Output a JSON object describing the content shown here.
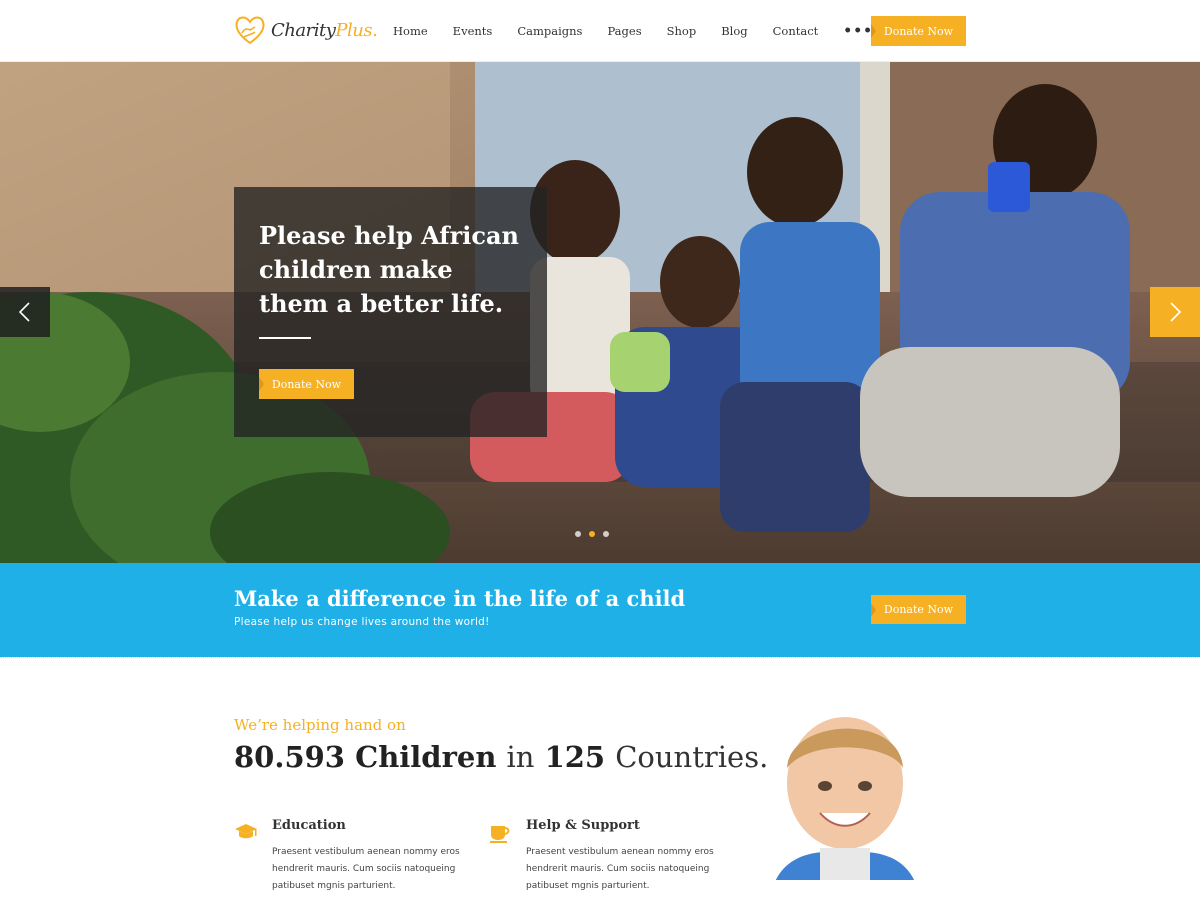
{
  "header": {
    "logo": {
      "name": "Charity",
      "accent": "Plus."
    },
    "nav": [
      "Home",
      "Events",
      "Campaigns",
      "Pages",
      "Shop",
      "Blog",
      "Contact"
    ],
    "more": "•••",
    "donate_label": "Donate Now"
  },
  "hero": {
    "title": "Please help African children make them a better life.",
    "donate_label": "Donate Now",
    "slides_count": 3,
    "active_slide": 2
  },
  "cta": {
    "title": "Make a difference in the life of a child",
    "subtitle": "Please help us change lives around the world!",
    "donate_label": "Donate Now"
  },
  "stats": {
    "kicker": "We’re helping hand on",
    "children_count": "80.593",
    "children_label": "Children",
    "in_label": "in",
    "countries_count": "125",
    "countries_label": "Countries.",
    "features": [
      {
        "title": "Education",
        "icon": "graduation-cap-icon",
        "text": "Praesent vestibulum aenean nommy eros hendrerit mauris. Cum sociis natoqueing patibuset mgnis parturient."
      },
      {
        "title": "Help & Support",
        "icon": "coffee-cup-icon",
        "text": "Praesent vestibulum aenean nommy eros hendrerit mauris. Cum sociis natoqueing patibuset mgnis parturient."
      }
    ]
  },
  "colors": {
    "accent": "#f6b024",
    "band": "#1eb0e6",
    "overlay": "#232323"
  }
}
